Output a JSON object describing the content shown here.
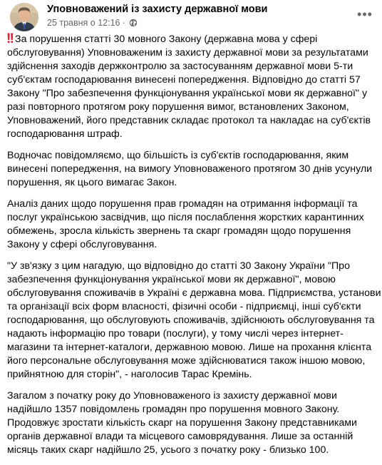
{
  "post": {
    "page_name": "Уповноважений із захисту державної мови",
    "date": "25 травня о 12:16",
    "separator": "·",
    "icons": {
      "audience": "globe-icon",
      "alert": "double-exclamation-icon",
      "more": "more-dots-icon"
    },
    "paragraphs": [
      {
        "lines": [
          "За порушення статті 30 мовного Закону (державна мова у сфері",
          "обслуговування) Уповноваженим із захисту державної мови за результатами",
          "здійснення заходів держконтролю за застосуванням державної мови 5-ти",
          "суб'єктам господарювання винесені попередження. Відповідно до статті 57",
          "Закону \"Про забезпечення функціонування української мови як державної\" у",
          "разі повторного протягом року порушення вимог, встановлених Законом,",
          "Уповноважений, його представник складає протокол та накладає на суб'єктів",
          "господарювання штраф."
        ]
      },
      {
        "lines": [
          "Водночас повідомляємо, що більшість із суб'єктів господарювання, яким",
          "винесені попередження, на вимогу Уповноваженого протягом 30 днів усунули",
          "порушення, як цього вимагає Закон."
        ]
      },
      {
        "lines": [
          "Аналіз даних щодо порушення прав громадян на отримання інформації та",
          "послуг українською засвідчив, що після послаблення жорстких карантинних",
          "обмежень, зросла кількість звернень та скарг громадян щодо порушення",
          "Закону у сфері обслуговування."
        ]
      },
      {
        "lines": [
          "\"У зв'язку з цим нагадую, що відповідно до статті 30 Закону України \"Про",
          "забезпечення функціонування української мови як державної\", мовою",
          "обслуговування споживачів в Україні є державна мова. Підприємства, установи",
          "та організації всіх форм власності, фізичні особи - підприємці, інші суб'єкти",
          "господарювання, що обслуговують споживачів, здійснюють обслуговування та",
          "надають інформацію про товари (послуги), у тому числі через інтернет-",
          "магазини та інтернет-каталоги, державною мовою. Лише на прохання клієнта",
          "його персональне обслуговування може здійснюватися також іншою мовою,",
          "прийнятною для сторін\", - наголосив Тарас Кремінь."
        ]
      },
      {
        "lines": [
          "Загалом з початку року до Уповноваженого із захисту державної мови",
          "надійшло 1357 повідомлень громадян про порушення мовного Закону.",
          "Продовжує зростати кількість скарг на порушення Закону представниками",
          "органів державної влади та місцевого самоврядування. Лише за останній",
          "місяць таких скарг надійшло 25, усього з початку року - близько 100."
        ]
      }
    ]
  }
}
